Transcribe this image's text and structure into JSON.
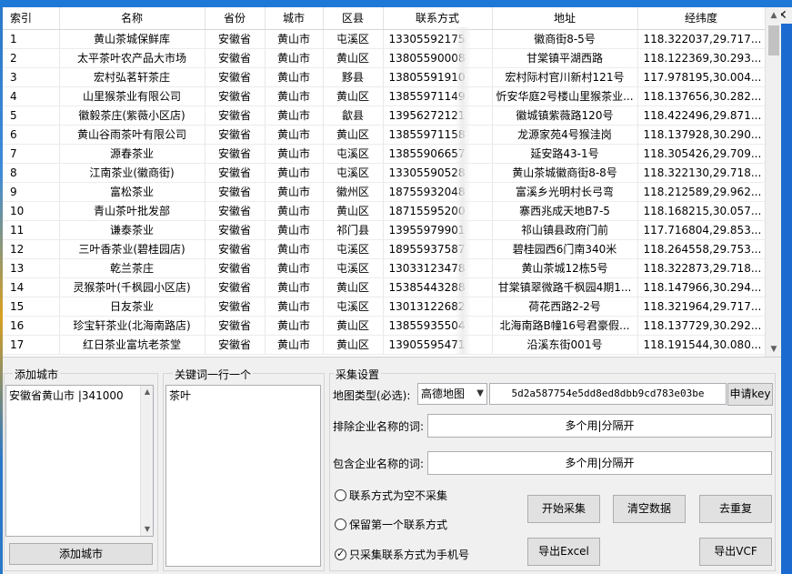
{
  "table": {
    "headers": [
      "索引",
      "名称",
      "省份",
      "城市",
      "区县",
      "联系方式",
      "地址",
      "经纬度"
    ],
    "rows": [
      [
        "1",
        "黄山茶城保鲜库",
        "安徽省",
        "黄山市",
        "屯溪区",
        "13305592175",
        "徽商街8-5号",
        "118.322037,29.717..."
      ],
      [
        "2",
        "太平茶叶农产品大市场",
        "安徽省",
        "黄山市",
        "黄山区",
        "13805590008",
        "甘棠镇平湖西路",
        "118.122369,30.293..."
      ],
      [
        "3",
        "宏村弘茗轩茶庄",
        "安徽省",
        "黄山市",
        "黟县",
        "13805591910",
        "宏村际村官川新村121号",
        "117.978195,30.004..."
      ],
      [
        "4",
        "山里猴茶业有限公司",
        "安徽省",
        "黄山市",
        "黄山区",
        "13855971149",
        "忻安华庭2号楼山里猴茶业...",
        "118.137656,30.282..."
      ],
      [
        "5",
        "徽毅茶庄(紫薇小区店)",
        "安徽省",
        "黄山市",
        "歙县",
        "13956272121",
        "徽城镇紫薇路120号",
        "118.422496,29.871..."
      ],
      [
        "6",
        "黄山谷雨茶叶有限公司",
        "安徽省",
        "黄山市",
        "黄山区",
        "13855971158",
        "龙源家苑4号猴洼岗",
        "118.137928,30.290..."
      ],
      [
        "7",
        "源春茶业",
        "安徽省",
        "黄山市",
        "屯溪区",
        "13855906657",
        "延安路43-1号",
        "118.305426,29.709..."
      ],
      [
        "8",
        "江南茶业(徽商街)",
        "安徽省",
        "黄山市",
        "屯溪区",
        "13305590528",
        "黄山茶城徽商街8-8号",
        "118.322130,29.718..."
      ],
      [
        "9",
        "富松茶业",
        "安徽省",
        "黄山市",
        "徽州区",
        "18755932048",
        "富溪乡光明村长弓弯",
        "118.212589,29.962..."
      ],
      [
        "10",
        "青山茶叶批发部",
        "安徽省",
        "黄山市",
        "黄山区",
        "18715595200",
        "寨西兆成天地B7-5",
        "118.168215,30.057..."
      ],
      [
        "11",
        "谦泰茶业",
        "安徽省",
        "黄山市",
        "祁门县",
        "13955979901",
        "祁山镇县政府门前",
        "117.716804,29.853..."
      ],
      [
        "12",
        "三叶香茶业(碧桂园店)",
        "安徽省",
        "黄山市",
        "屯溪区",
        "18955937587",
        "碧桂园西6门南340米",
        "118.264558,29.753..."
      ],
      [
        "13",
        "乾兰茶庄",
        "安徽省",
        "黄山市",
        "屯溪区",
        "13033123478",
        "黄山茶城12栋5号",
        "118.322873,29.718..."
      ],
      [
        "14",
        "灵猴茶叶(千枫园小区店)",
        "安徽省",
        "黄山市",
        "黄山区",
        "15385443288",
        "甘棠镇翠微路千枫园4期1...",
        "118.147966,30.294..."
      ],
      [
        "15",
        "日友茶业",
        "安徽省",
        "黄山市",
        "屯溪区",
        "13013122682",
        "荷花西路2-2号",
        "118.321964,29.717..."
      ],
      [
        "16",
        "珍宝轩茶业(北海南路店)",
        "安徽省",
        "黄山市",
        "黄山区",
        "13855935504",
        "北海南路B幢16号君豪假...",
        "118.137729,30.292..."
      ],
      [
        "17",
        "红日茶业富坑老茶堂",
        "安徽省",
        "黄山市",
        "黄山区",
        "13905595471",
        "沿溪东街001号",
        "118.191544,30.080..."
      ]
    ]
  },
  "cities": {
    "legend": "添加城市",
    "value": "安徽省黄山市 |341000",
    "add_button": "添加城市"
  },
  "keywords": {
    "legend": "关键词一行一个",
    "value": "茶叶"
  },
  "settings": {
    "legend": "采集设置",
    "map_type_label": "地图类型(必选):",
    "map_type_value": "高德地图",
    "api_key": "5d2a587754e5dd8ed8dbb9cd783e03be",
    "apply_key_button": "申请key",
    "exclude_label": "排除企业名称的词:",
    "exclude_value": "多个用|分隔开",
    "include_label": "包含企业名称的词:",
    "include_value": "多个用|分隔开",
    "opt_empty_contact": "联系方式为空不采集",
    "opt_keep_first": "保留第一个联系方式",
    "opt_mobile_only": "只采集联系方式为手机号",
    "start_button": "开始采集",
    "clear_button": "清空数据",
    "dedupe_button": "去重复",
    "export_excel_button": "导出Excel",
    "export_vcf_button": "导出VCF"
  }
}
